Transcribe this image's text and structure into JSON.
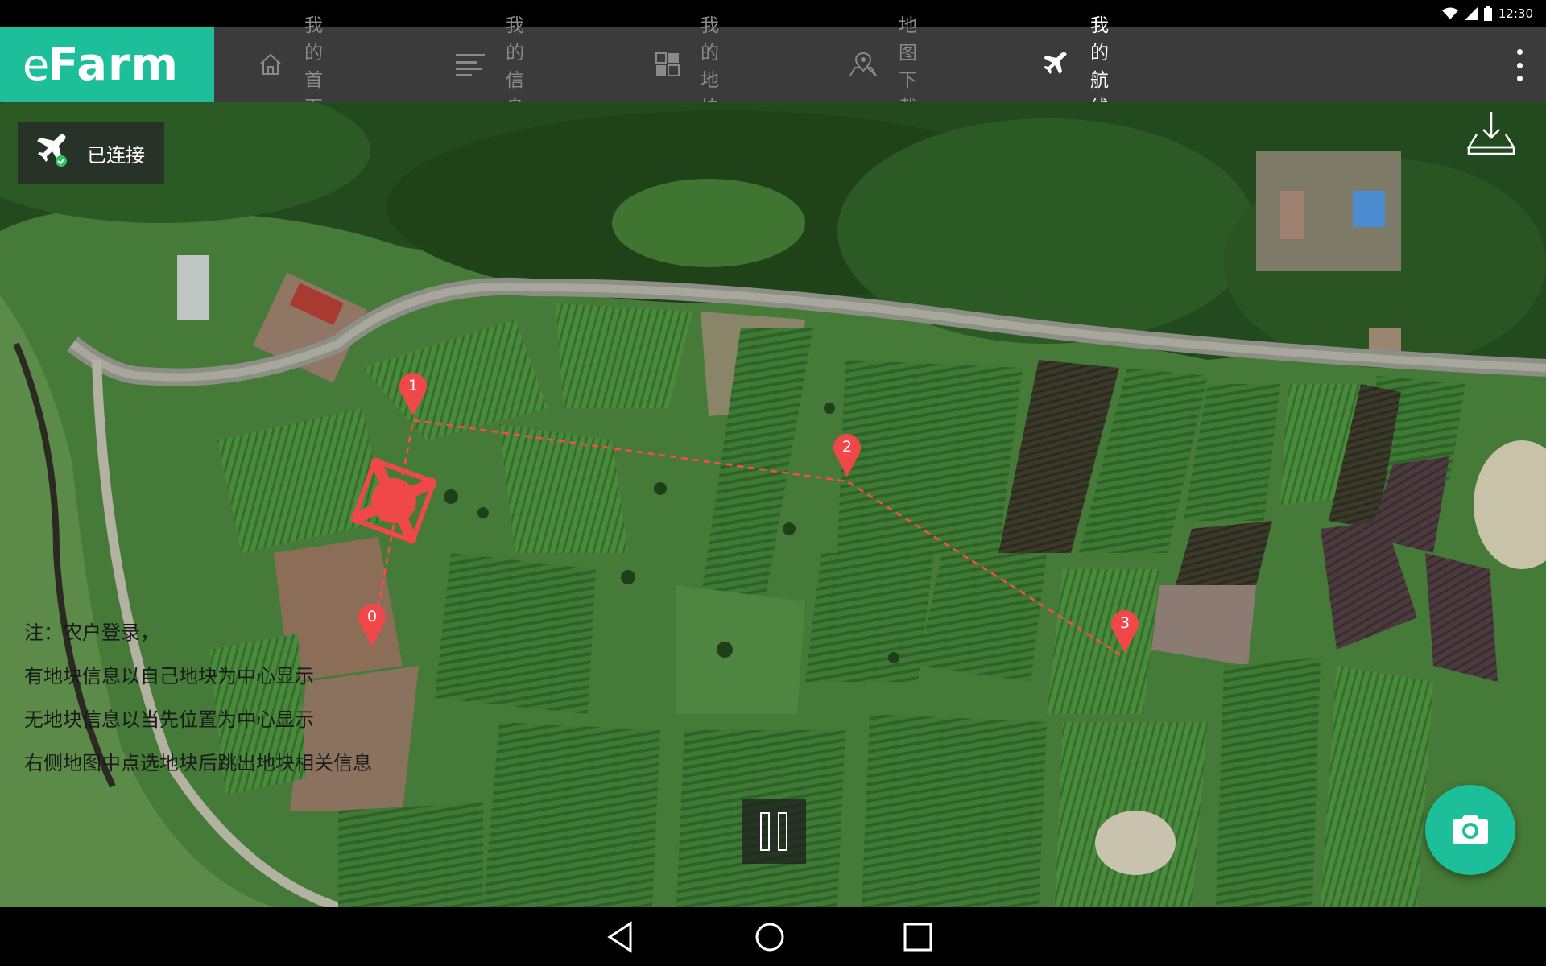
{
  "status_bar": {
    "time": "12:30"
  },
  "header": {
    "logo": {
      "e": "e",
      "rest": "Farm"
    },
    "nav": [
      {
        "label": "我的首页",
        "icon": "home-icon",
        "active": false
      },
      {
        "label": "我的信息",
        "icon": "list-icon",
        "active": false
      },
      {
        "label": "我的地块",
        "icon": "grid-icon",
        "active": false
      },
      {
        "label": "地图下载",
        "icon": "map-pin-icon",
        "active": false
      },
      {
        "label": "我的航线",
        "icon": "airplane-icon",
        "active": true
      }
    ]
  },
  "map": {
    "connection_status": "已连接",
    "waypoints": [
      {
        "label": "0"
      },
      {
        "label": "1"
      },
      {
        "label": "2"
      },
      {
        "label": "3"
      }
    ],
    "note_lines": [
      "注：农户登录，",
      "有地块信息以自己地块为中心显示",
      "无地块信息以当先位置为中心显示",
      "右侧地图中点选地块后跳出地块相关信息"
    ]
  },
  "colors": {
    "accent": "#1dbf9a",
    "header_bg": "#3b3b3b",
    "waypoint": "#f04848",
    "route_line": "#ff4a4a"
  }
}
